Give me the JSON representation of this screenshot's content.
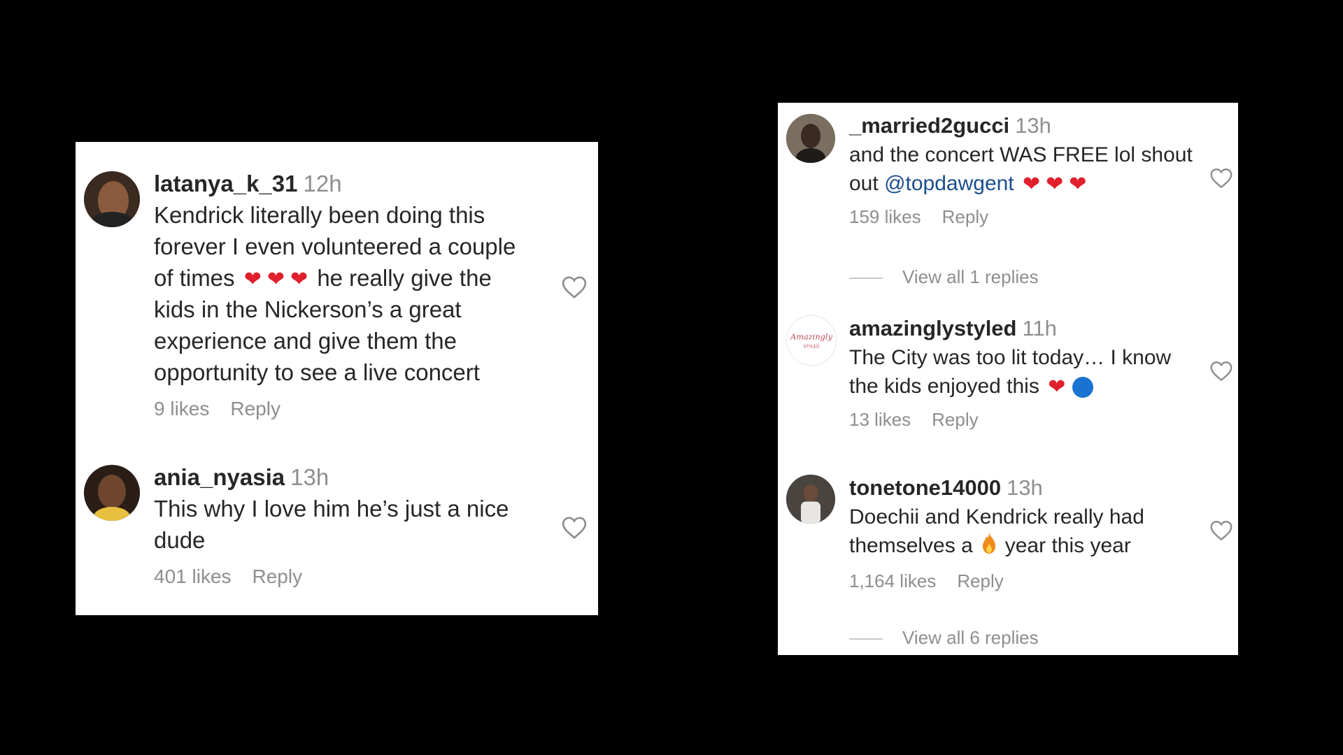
{
  "left_panel": {
    "comments": [
      {
        "username": "latanya_k_31",
        "time": "12h",
        "text_lines": [
          "Kendrick literally been doing this",
          "forever I even volunteered a couple",
          "of times",
          "he really give the",
          "kids in the Nickerson’s a great",
          "experience and give them the",
          "opportunity to see a live concert"
        ],
        "emojis": [
          "red-heart",
          "red-heart",
          "red-heart"
        ],
        "likes": "9 likes",
        "reply": "Reply"
      },
      {
        "username": "ania_nyasia",
        "time": "13h",
        "text_lines": [
          "This why I love him he’s just a nice",
          "dude"
        ],
        "likes": "401 likes",
        "reply": "Reply"
      }
    ]
  },
  "right_panel": {
    "comments": [
      {
        "username": "_married2gucci",
        "time": "13h",
        "text_lines": [
          "and the concert WAS FREE lol shout",
          "out"
        ],
        "mention": "@topdawgent",
        "emojis": [
          "red-heart",
          "red-heart",
          "red-heart"
        ],
        "likes": "159 likes",
        "reply": "Reply",
        "view_replies": "View all 1 replies"
      },
      {
        "username": "amazinglystyled",
        "time": "11h",
        "text_lines": [
          "The City was too lit today… I know",
          "the kids enjoyed this"
        ],
        "emojis": [
          "red-heart",
          "blue-circle"
        ],
        "likes": "13 likes",
        "reply": "Reply"
      },
      {
        "username": "tonetone14000",
        "time": "13h",
        "text_lines": [
          "Doechii and Kendrick really had",
          "themselves a",
          "year this year"
        ],
        "emojis": [
          "fire"
        ],
        "likes": "1,164 likes",
        "reply": "Reply",
        "view_replies": "View all 6 replies"
      }
    ]
  },
  "colors": {
    "background": "#000000",
    "panel": "#ffffff",
    "text": "#262626",
    "muted": "#8e8e8e",
    "mention": "#1c4e8c",
    "heart": "#e0202d",
    "blue_circle": "#1a73d0",
    "fire": "#f08a1c"
  },
  "icons": {
    "like": "heart-outline-icon",
    "emoji_heart": "red-heart-emoji",
    "emoji_blue": "blue-circle-emoji",
    "emoji_fire": "fire-emoji"
  }
}
